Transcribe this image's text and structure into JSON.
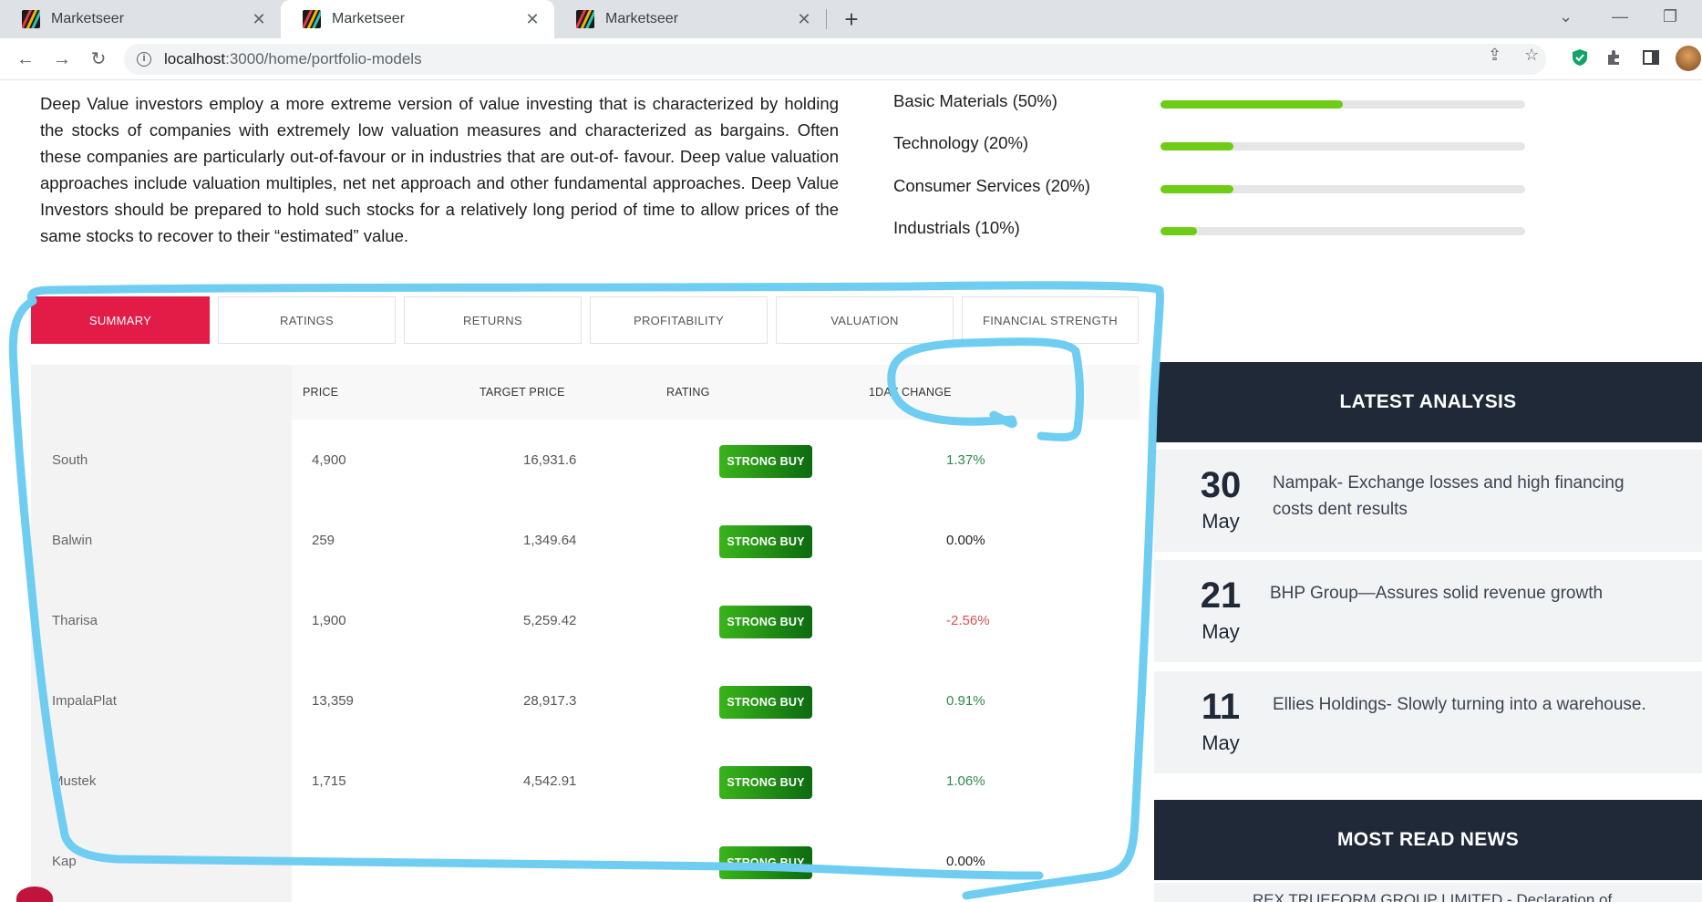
{
  "browser": {
    "tabs": [
      {
        "title": "Marketseer"
      },
      {
        "title": "Marketseer"
      },
      {
        "title": "Marketseer"
      }
    ],
    "url_host": "localhost",
    "url_path": ":3000/home/portfolio-models"
  },
  "intro": {
    "text": "Deep Value investors employ a more extreme version of value investing that is characterized by holding the stocks of companies with extremely low valuation measures and characterized as bargains. Often these companies are particularly out-of-favour or in industries that are out-of- favour. Deep value valuation approaches include valuation multiples, net net approach and other fundamental approaches. Deep Value Investors should be prepared to hold such stocks for a relatively long period of time to allow prices of the same stocks to recover to their “estimated” value."
  },
  "sectors": [
    {
      "label": "Basic Materials (50%)",
      "value": 0.5
    },
    {
      "label": "Technology (20%)",
      "value": 0.2
    },
    {
      "label": "Consumer Services (20%)",
      "value": 0.2
    },
    {
      "label": "Industrials (10%)",
      "value": 0.1
    }
  ],
  "tabs": [
    "SUMMARY",
    "RATINGS",
    "RETURNS",
    "PROFITABILITY",
    "VALUATION",
    "FINANCIAL STRENGTH"
  ],
  "table": {
    "headers": {
      "price": "PRICE",
      "target": "TARGET PRICE",
      "rating": "RATING",
      "change": "1DAY CHANGE"
    },
    "rows": [
      {
        "name": "South",
        "price": "4,900",
        "target": "16,931.6",
        "rating": "STRONG BUY",
        "change": "1.37%",
        "change_color": "#2e8b4a"
      },
      {
        "name": "Balwin",
        "price": "259",
        "target": "1,349.64",
        "rating": "STRONG BUY",
        "change": "0.00%",
        "change_color": "#222222"
      },
      {
        "name": "Tharisa",
        "price": "1,900",
        "target": "5,259.42",
        "rating": "STRONG BUY",
        "change": "-2.56%",
        "change_color": "#d9534f"
      },
      {
        "name": "ImpalaPlat",
        "price": "13,359",
        "target": "28,917.3",
        "rating": "STRONG BUY",
        "change": "0.91%",
        "change_color": "#2e8b4a"
      },
      {
        "name": "Mustek",
        "price": "1,715",
        "target": "4,542.91",
        "rating": "STRONG BUY",
        "change": "1.06%",
        "change_color": "#2e8b4a"
      },
      {
        "name": "Kap",
        "price": "",
        "target": "",
        "rating": "STRONG BUY",
        "change": "0.00%",
        "change_color": "#222222"
      }
    ]
  },
  "latest_analysis": {
    "title": "LATEST ANALYSIS",
    "items": [
      {
        "day": "30",
        "month": "May",
        "title": "Nampak- Exchange losses and high financing costs dent results"
      },
      {
        "day": "21",
        "month": "May",
        "title": "BHP Group—Assures solid revenue growth"
      },
      {
        "day": "11",
        "month": "May",
        "title": "Ellies Holdings- Slowly turning into a warehouse."
      }
    ]
  },
  "most_read": {
    "title": "MOST READ NEWS",
    "first_item": "REX TRUEFORM GROUP LIMITED - Declaration of"
  },
  "colors": {
    "accent": "#e31b47",
    "bar_fill": "#6ecc16",
    "badge": "#1d8a14",
    "panel": "#1f2937",
    "annotation": "#6fcdf2"
  }
}
